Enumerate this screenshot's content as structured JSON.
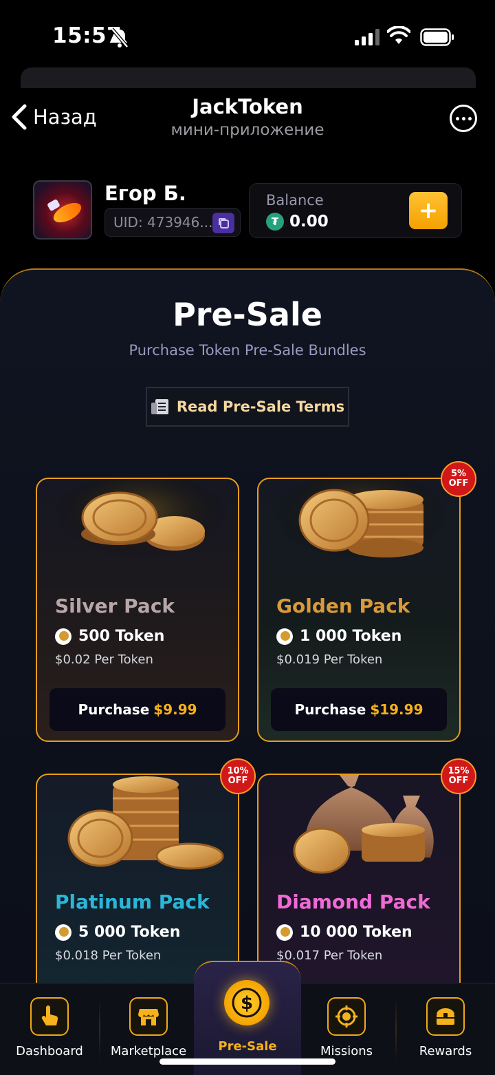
{
  "status_bar": {
    "time": "15:57"
  },
  "header": {
    "back_label": "Назад",
    "title": "JackToken",
    "subtitle": "мини-приложение"
  },
  "profile": {
    "name": "Егор Б.",
    "uid": "UID: 473946..."
  },
  "balance": {
    "label": "Balance",
    "value": "0.00",
    "currency_icon": "tether-icon",
    "add_label": "+"
  },
  "presale": {
    "title": "Pre-Sale",
    "subtitle": "Purchase Token Pre-Sale Bundles",
    "terms_label": "Read Pre-Sale Terms"
  },
  "packs": [
    {
      "name": "Silver Pack",
      "name_color": "#b8a7a8",
      "tokens": "500 Token",
      "per_token": "$0.02 Per Token",
      "buy_label": "Purchase",
      "price": "$9.99",
      "discount": ""
    },
    {
      "name": "Golden Pack",
      "name_color": "#d89a3c",
      "tokens": "1 000 Token",
      "per_token": "$0.019 Per Token",
      "buy_label": "Purchase",
      "price": "$19.99",
      "discount": "5%",
      "discount_suffix": "OFF"
    },
    {
      "name": "Platinum Pack",
      "name_color": "#2bb6d8",
      "tokens": "5 000 Token",
      "per_token": "$0.018 Per Token",
      "discount": "10%",
      "discount_suffix": "OFF"
    },
    {
      "name": "Diamond Pack",
      "name_color": "#f06ad6",
      "tokens": "10 000 Token",
      "per_token": "$0.017 Per Token",
      "discount": "15%",
      "discount_suffix": "OFF"
    }
  ],
  "nav": {
    "items": [
      {
        "label": "Dashboard",
        "icon": "hand-pointer-icon"
      },
      {
        "label": "Marketplace",
        "icon": "store-icon"
      },
      {
        "label": "Pre-Sale",
        "icon": "dollar-coin-icon"
      },
      {
        "label": "Missions",
        "icon": "target-icon"
      },
      {
        "label": "Rewards",
        "icon": "treasure-chest-icon"
      }
    ],
    "active_index": 2
  },
  "colors": {
    "accent": "#f6b21c",
    "background": "#0b0e18",
    "discount_badge": "#d01818"
  }
}
